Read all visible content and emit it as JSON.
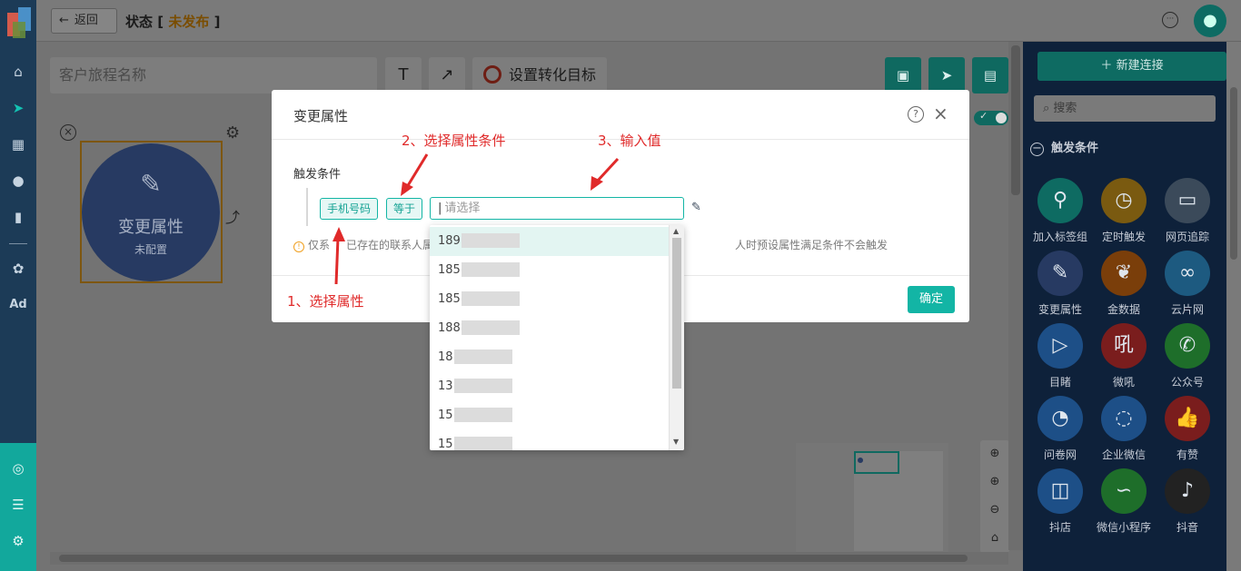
{
  "topbar": {
    "back_label": "返回",
    "title": "状态",
    "status": "未发布"
  },
  "toolbar": {
    "name_placeholder": "客户旅程名称",
    "text_tool": "T",
    "arrow_tool": "↗",
    "goal_label": "设置转化目标"
  },
  "node": {
    "title": "变更属性",
    "subtitle": "未配置"
  },
  "right_panel": {
    "new_connection": "新建连接",
    "search_placeholder": "搜索",
    "section_title": "触发条件",
    "items": [
      {
        "label": "加入标签组",
        "icon": "user-plus-icon",
        "color": "#0e6b62"
      },
      {
        "label": "定时触发",
        "icon": "clock-icon",
        "color": "#7a5a10"
      },
      {
        "label": "网页追踪",
        "icon": "webpage-icon",
        "color": "#3b4a5a"
      },
      {
        "label": "变更属性",
        "icon": "edit-icon",
        "color": "#273a62"
      },
      {
        "label": "金数据",
        "icon": "jinshuju-icon",
        "color": "#7a3e0a"
      },
      {
        "label": "云片网",
        "icon": "yunpian-icon",
        "color": "#1d5a80"
      },
      {
        "label": "目睹",
        "icon": "play-icon",
        "color": "#1d4f87"
      },
      {
        "label": "微吼",
        "icon": "weihou-icon",
        "color": "#7a1d1d"
      },
      {
        "label": "公众号",
        "icon": "wechat-icon",
        "color": "#1e6e2a"
      },
      {
        "label": "问卷网",
        "icon": "wenjuan-icon",
        "color": "#1d4f87"
      },
      {
        "label": "企业微信",
        "icon": "wecom-icon",
        "color": "#1d4f87"
      },
      {
        "label": "有赞",
        "icon": "thumb-up-icon",
        "color": "#7a1d1d"
      },
      {
        "label": "抖店",
        "icon": "doudian-icon",
        "color": "#1d4f87"
      },
      {
        "label": "微信小程序",
        "icon": "miniprogram-icon",
        "color": "#1e6e2a"
      },
      {
        "label": "抖音",
        "icon": "douyin-icon",
        "color": "#222"
      }
    ]
  },
  "modal": {
    "title": "变更属性",
    "trigger_label": "触发条件",
    "tag_attribute": "手机号码",
    "tag_operator": "等于",
    "value_placeholder": "请选择",
    "hint_prefix": "仅系",
    "hint_mid": "已存在的联系人属",
    "hint_suffix": "人时预设属性满足条件不会触发",
    "confirm": "确定"
  },
  "annotations": {
    "step1": "1、选择属性",
    "step2": "2、选择属性条件",
    "step3": "3、输入值"
  },
  "dropdown": {
    "options": [
      "189",
      "185",
      "185",
      "188",
      "18",
      "13",
      "15",
      "15"
    ]
  },
  "colors": {
    "accent": "#13b5a5",
    "annotation": "#e02a2a"
  }
}
